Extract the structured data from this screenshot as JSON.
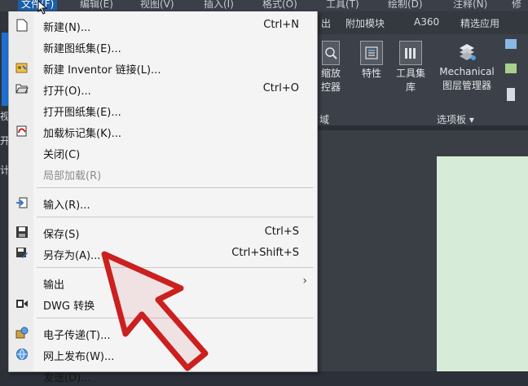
{
  "menubar": {
    "items": [
      "文件(F)",
      "编辑(E)",
      "视图(V)",
      "插入(I)",
      "格式(O)",
      "工具(T)",
      "绘制(D)",
      "注释(N)",
      "修"
    ]
  },
  "ribbon": {
    "tabs": [
      "出",
      "附加模块",
      "A360",
      "精选应用"
    ],
    "tools": [
      {
        "label": "缩放\n控器",
        "icon": "zoom-controller-icon"
      },
      {
        "label": "特性",
        "icon": "properties-icon"
      },
      {
        "label": "工具集\n库",
        "icon": "toolset-library-icon"
      },
      {
        "label": "Mechanical\n图层管理器",
        "icon": "layer-manager-icon"
      }
    ],
    "panel_labels": [
      "域",
      "选项板 ▾"
    ],
    "left_fragments": [
      "视",
      "开",
      "计"
    ]
  },
  "file_menu": {
    "items": [
      {
        "id": "new",
        "label": "新建(N)...",
        "shortcut": "Ctrl+N",
        "icon": "new-document-icon"
      },
      {
        "id": "new-sheet-set",
        "label": "新建图纸集(E)...",
        "shortcut": "",
        "icon": ""
      },
      {
        "id": "new-inventor-link",
        "label": "新建 Inventor 链接(L)...",
        "shortcut": "",
        "icon": "inventor-link-icon"
      },
      {
        "id": "open",
        "label": "打开(O)...",
        "shortcut": "Ctrl+O",
        "icon": "open-folder-icon"
      },
      {
        "id": "open-sheet-set",
        "label": "打开图纸集(E)...",
        "shortcut": "",
        "icon": ""
      },
      {
        "id": "load-markup-set",
        "label": "加载标记集(K)...",
        "shortcut": "",
        "icon": "markup-set-icon"
      },
      {
        "id": "close",
        "label": "关闭(C)",
        "shortcut": "",
        "icon": ""
      },
      {
        "id": "partial-load",
        "label": "局部加载(R)",
        "shortcut": "",
        "icon": "",
        "disabled": true
      },
      {
        "id": "import",
        "label": "输入(R)...",
        "shortcut": "",
        "icon": "import-icon"
      },
      {
        "id": "save",
        "label": "保存(S)",
        "shortcut": "Ctrl+S",
        "icon": "save-icon"
      },
      {
        "id": "save-as",
        "label": "另存为(A)...",
        "shortcut": "Ctrl+Shift+S",
        "icon": "save-as-icon"
      },
      {
        "id": "export",
        "label": "输出",
        "shortcut": "",
        "icon": "",
        "submenu": "›"
      },
      {
        "id": "dwg-convert",
        "label": "DWG 转换",
        "shortcut": "",
        "icon": "dwg-convert-icon"
      },
      {
        "id": "etransmit",
        "label": "电子传递(T)...",
        "shortcut": "",
        "icon": "etransmit-icon"
      },
      {
        "id": "publish-web",
        "label": "网上发布(W)...",
        "shortcut": "",
        "icon": "publish-web-icon"
      },
      {
        "id": "send",
        "label": "发送(D)...",
        "shortcut": "",
        "icon": ""
      }
    ]
  },
  "colors": {
    "menu_bg": "#f4f4f4",
    "ribbon_bg": "#3c4048",
    "viewport_bg": "#d7ecd8",
    "cursor_red": "#cc1f1f"
  }
}
